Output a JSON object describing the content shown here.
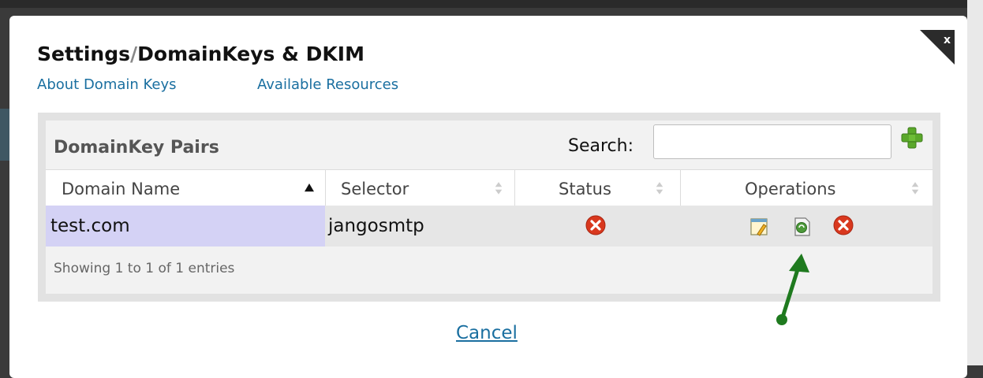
{
  "dialog": {
    "title_part1": "Settings",
    "title_sep": "/",
    "title_part2": "DomainKeys & DKIM",
    "links": {
      "about": "About Domain Keys",
      "resources": "Available Resources"
    },
    "close_icon": "close-icon"
  },
  "table": {
    "title": "DomainKey Pairs",
    "search_label": "Search:",
    "search_value": "",
    "columns": [
      "Domain Name",
      "Selector",
      "Status",
      "Operations"
    ],
    "rows": [
      {
        "domain": "test.com",
        "selector": "jangosmtp",
        "status_icon": "red-x-icon",
        "operations": [
          "edit-icon",
          "view-icon",
          "delete-icon"
        ]
      }
    ],
    "info": "Showing 1 to 1 of 1 entries"
  },
  "footer": {
    "cancel_label": "Cancel"
  },
  "colors": {
    "link": "#1a6fa0",
    "selected_cell": "#d4d2f5",
    "status_red": "#d9381e",
    "add_green": "#5aa82a",
    "annotation_arrow": "#1f7a1f"
  }
}
